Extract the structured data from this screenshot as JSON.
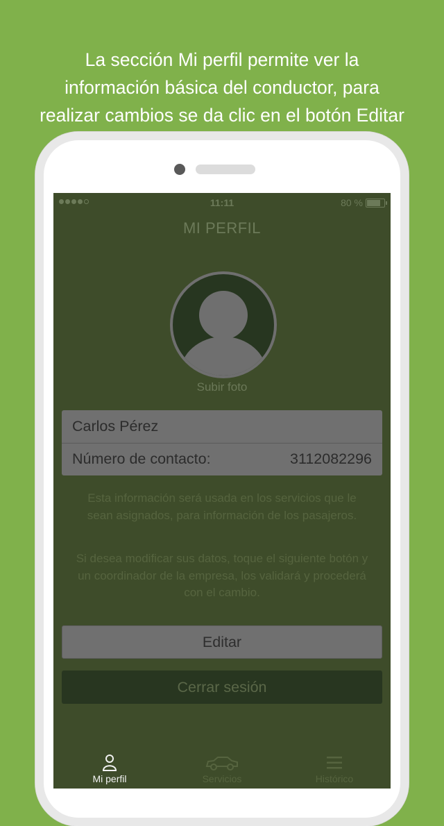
{
  "caption": {
    "line1": "La sección Mi perfil permite ver la",
    "line2": "información básica del conductor, para",
    "line3": "realizar cambios se da clic en el botón Editar"
  },
  "statusbar": {
    "time": "11:11",
    "battery": "80 %"
  },
  "header": {
    "title": "MI PERFIL"
  },
  "profile": {
    "upload_label": "Subir foto",
    "name": "Carlos Pérez",
    "contact_label": "Número de contacto:",
    "contact_value": "3112082296"
  },
  "notes": {
    "p1": "Esta información será usada en los servicios que le sean asignados, para información de los pasajeros.",
    "p2": "Si desea modificar sus datos, toque el siguiente botón y un coordinador de la empresa, los validará y procederá con el cambio."
  },
  "actions": {
    "edit_label": "Editar",
    "logout_label": "Cerrar sesión"
  },
  "tabs": [
    {
      "label": "Mi perfil",
      "icon": "person-icon",
      "active": true
    },
    {
      "label": "Servicios",
      "icon": "car-icon",
      "active": false
    },
    {
      "label": "Histórico",
      "icon": "menu-icon",
      "active": false
    }
  ],
  "colors": {
    "background": "#80b14b",
    "screen": "#3e4c2a",
    "card": "#707070",
    "logout": "#283620"
  }
}
